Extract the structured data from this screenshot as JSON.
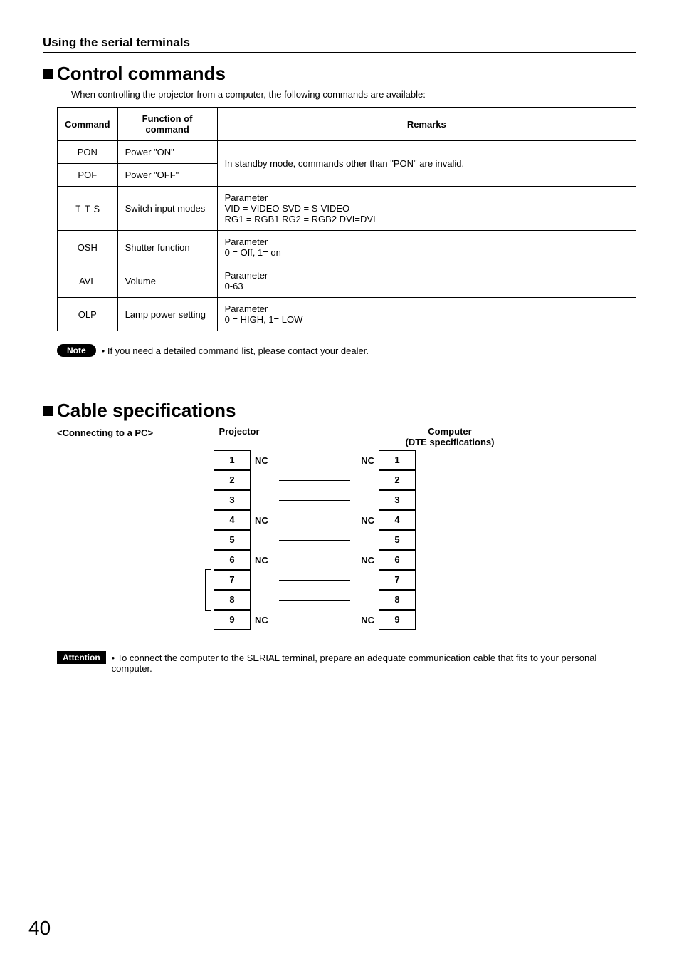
{
  "section_title": "Using the serial terminals",
  "heading1": "Control commands",
  "intro1": "When controlling the projector from a computer, the following commands are available:",
  "table": {
    "headers": {
      "c1": "Command",
      "c2": "Function of command",
      "c3": "Remarks"
    },
    "rows": [
      {
        "cmd": "PON",
        "func": "Power \"ON\"",
        "remarks": "In standby mode, commands other than \"PON\" are invalid.",
        "rowspan": 2
      },
      {
        "cmd": "POF",
        "func": "Power \"OFF\""
      },
      {
        "cmd": "ＩＩＳ",
        "func": "Switch input modes",
        "remarks": "Parameter\nVID = VIDEO       SVD = S-VIDEO\nRG1 = RGB1      RG2 = RGB2       DVI=DVI"
      },
      {
        "cmd": "OSH",
        "func": "Shutter function",
        "remarks": "Parameter\n0 = Off, 1= on"
      },
      {
        "cmd": "AVL",
        "func": "Volume",
        "remarks": "Parameter\n0-63"
      },
      {
        "cmd": "OLP",
        "func": "Lamp power setting",
        "remarks": "Parameter\n0 = HIGH, 1= LOW"
      }
    ]
  },
  "note_label": "Note",
  "note_text": "• If you need a detailed command list, please contact your dealer.",
  "heading2": "Cable specifications",
  "connecting_label": "<Connecting to a PC>",
  "pinout": {
    "projector_label": "Projector",
    "computer_label_l1": "Computer",
    "computer_label_l2": "(DTE specifications)",
    "rows": [
      {
        "l": "1",
        "ncl": "NC",
        "conn": false,
        "ncr": "NC",
        "r": "1"
      },
      {
        "l": "2",
        "ncl": "",
        "conn": true,
        "ncr": "",
        "r": "2"
      },
      {
        "l": "3",
        "ncl": "",
        "conn": true,
        "ncr": "",
        "r": "3"
      },
      {
        "l": "4",
        "ncl": "NC",
        "conn": false,
        "ncr": "NC",
        "r": "4"
      },
      {
        "l": "5",
        "ncl": "",
        "conn": true,
        "ncr": "",
        "r": "5"
      },
      {
        "l": "6",
        "ncl": "NC",
        "conn": false,
        "ncr": "NC",
        "r": "6"
      },
      {
        "l": "7",
        "ncl": "",
        "conn": true,
        "ncr": "",
        "r": "7"
      },
      {
        "l": "8",
        "ncl": "",
        "conn": true,
        "ncr": "",
        "r": "8"
      },
      {
        "l": "9",
        "ncl": "NC",
        "conn": false,
        "ncr": "NC",
        "r": "9"
      }
    ]
  },
  "attention_label": "Attention",
  "attention_text": "• To connect the computer to the SERIAL terminal, prepare an adequate communication cable that fits to your personal computer.",
  "page_number": "40"
}
